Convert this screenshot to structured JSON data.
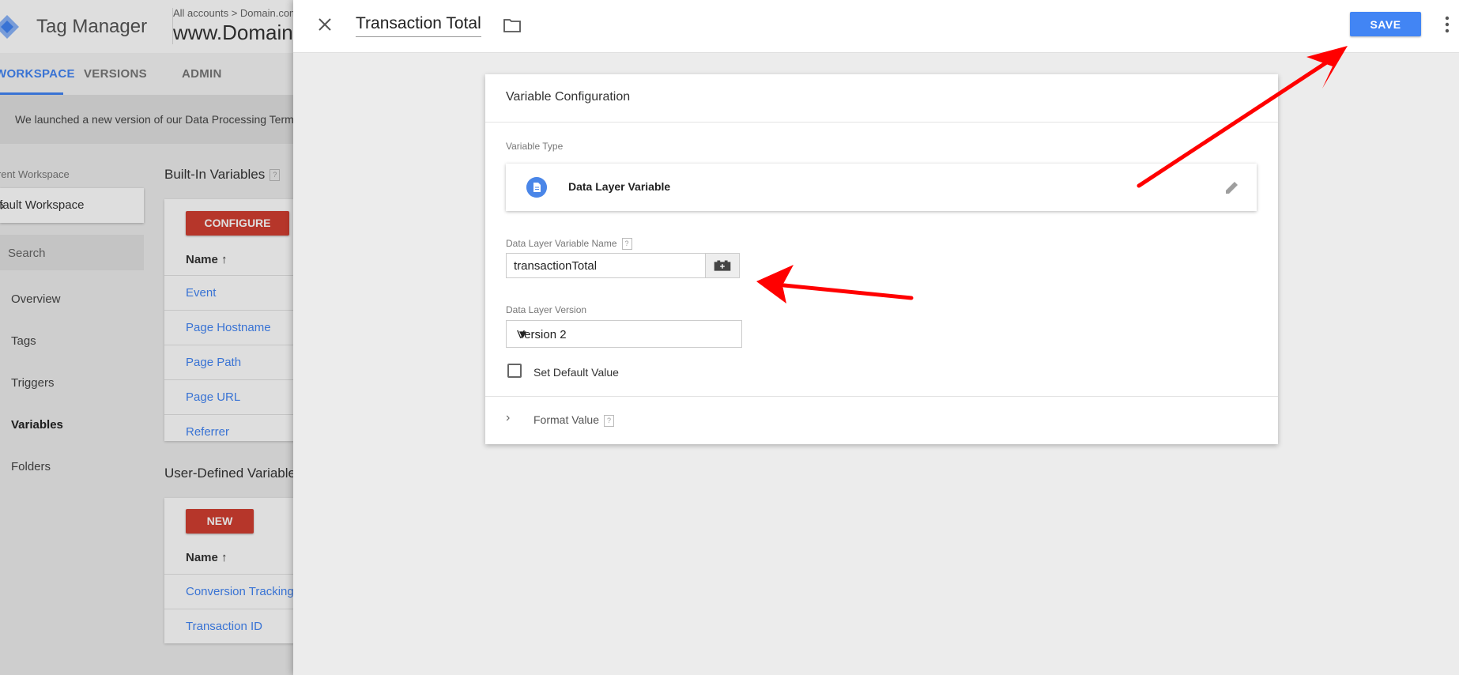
{
  "background": {
    "app_name": "Tag Manager",
    "breadcrumb": "All accounts  >  Domain.com",
    "container_name": "www.Domain.com",
    "tabs": [
      "WORKSPACE",
      "VERSIONS",
      "ADMIN"
    ],
    "banner": "We launched a new version of our Data Processing Terms",
    "workspace_label": "Current Workspace",
    "workspace_name": "Default Workspace",
    "search_placeholder": "Search",
    "nav": [
      "Overview",
      "Tags",
      "Triggers",
      "Variables",
      "Folders"
    ],
    "builtin_title": "Built-In Variables",
    "configure_label": "CONFIGURE",
    "name_header": "Name",
    "builtin_rows": [
      "Event",
      "Page Hostname",
      "Page Path",
      "Page URL",
      "Referrer"
    ],
    "userdefined_title": "User-Defined Variables",
    "new_label": "NEW",
    "userdefined_rows": [
      "Conversion Tracking ID",
      "Transaction ID"
    ],
    "help_mark": "?"
  },
  "panel": {
    "title": "Transaction Total",
    "save_label": "SAVE",
    "config": {
      "heading": "Variable Configuration",
      "variable_type_label": "Variable Type",
      "variable_type_name": "Data Layer Variable",
      "dlv_name_label": "Data Layer Variable Name",
      "dlv_name_value": "transactionTotal",
      "version_label": "Data Layer Version",
      "version_value": "Version 2",
      "default_value_label": "Set Default Value",
      "default_value_checked": false,
      "format_value_label": "Format Value",
      "help_mark": "?"
    }
  },
  "colors": {
    "primary_blue": "#4285f4",
    "accent_red": "#d23f31",
    "annotation_red": "#ff0000"
  }
}
